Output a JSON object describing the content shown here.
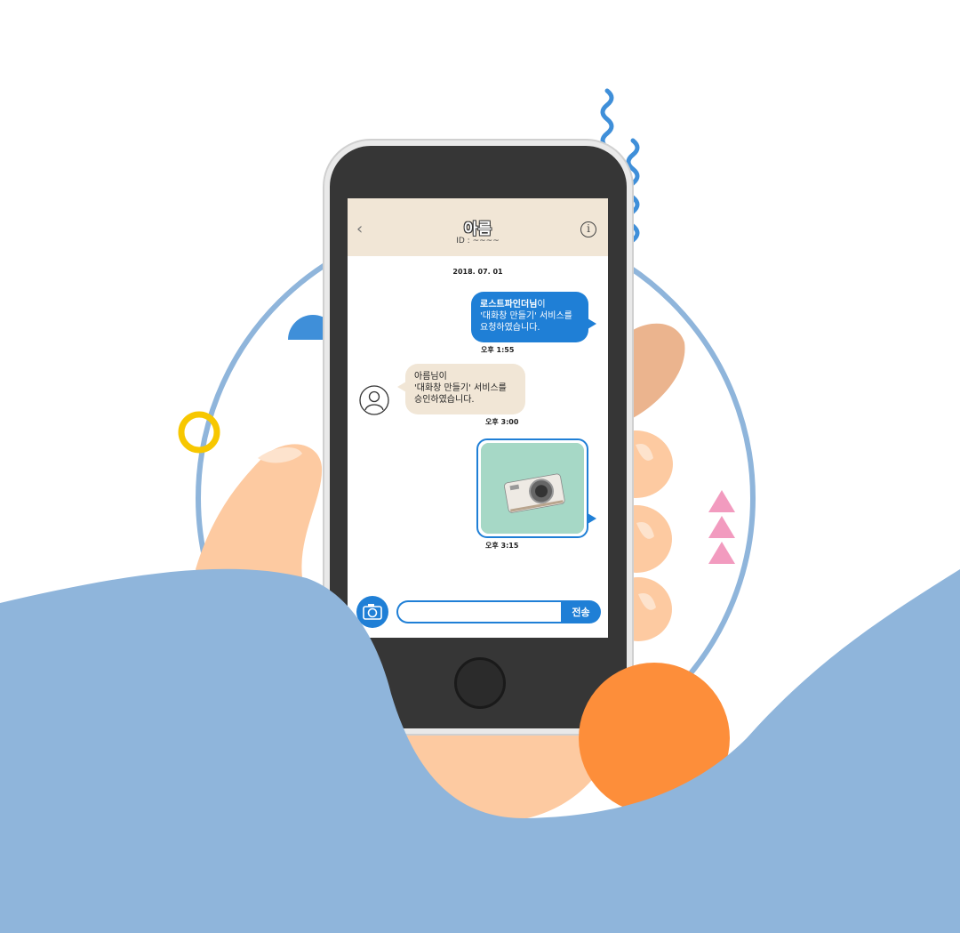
{
  "chat": {
    "back_icon": "‹",
    "contact_name": "아름",
    "contact_id": "ID : ~~~~",
    "info_icon": "i",
    "date": "2018. 07. 01",
    "outgoing": {
      "sender_bold": "로스트파인더님",
      "sender_suffix": "이",
      "line2": "'대화창 만들기' 서비스를",
      "line3": "요청하였습니다.",
      "time": "오후 1:55"
    },
    "incoming": {
      "sender": "아름님이",
      "line2": "'대화창 만들기' 서비스를",
      "line3": "승인하였습니다.",
      "time": "오후 3:00"
    },
    "photo_time": "오후 3:15",
    "input": {
      "value": "",
      "placeholder": ""
    },
    "send_label": "전송"
  },
  "colors": {
    "accent": "#1f7fd6",
    "header_bg": "#f1e6d6",
    "phone_body": "#363636",
    "wave": "#8fb5db",
    "orange": "#fd8e3a",
    "hand": "#fdcaa1"
  },
  "icons": [
    "back-icon",
    "info-icon",
    "avatar-icon",
    "camera-icon"
  ]
}
